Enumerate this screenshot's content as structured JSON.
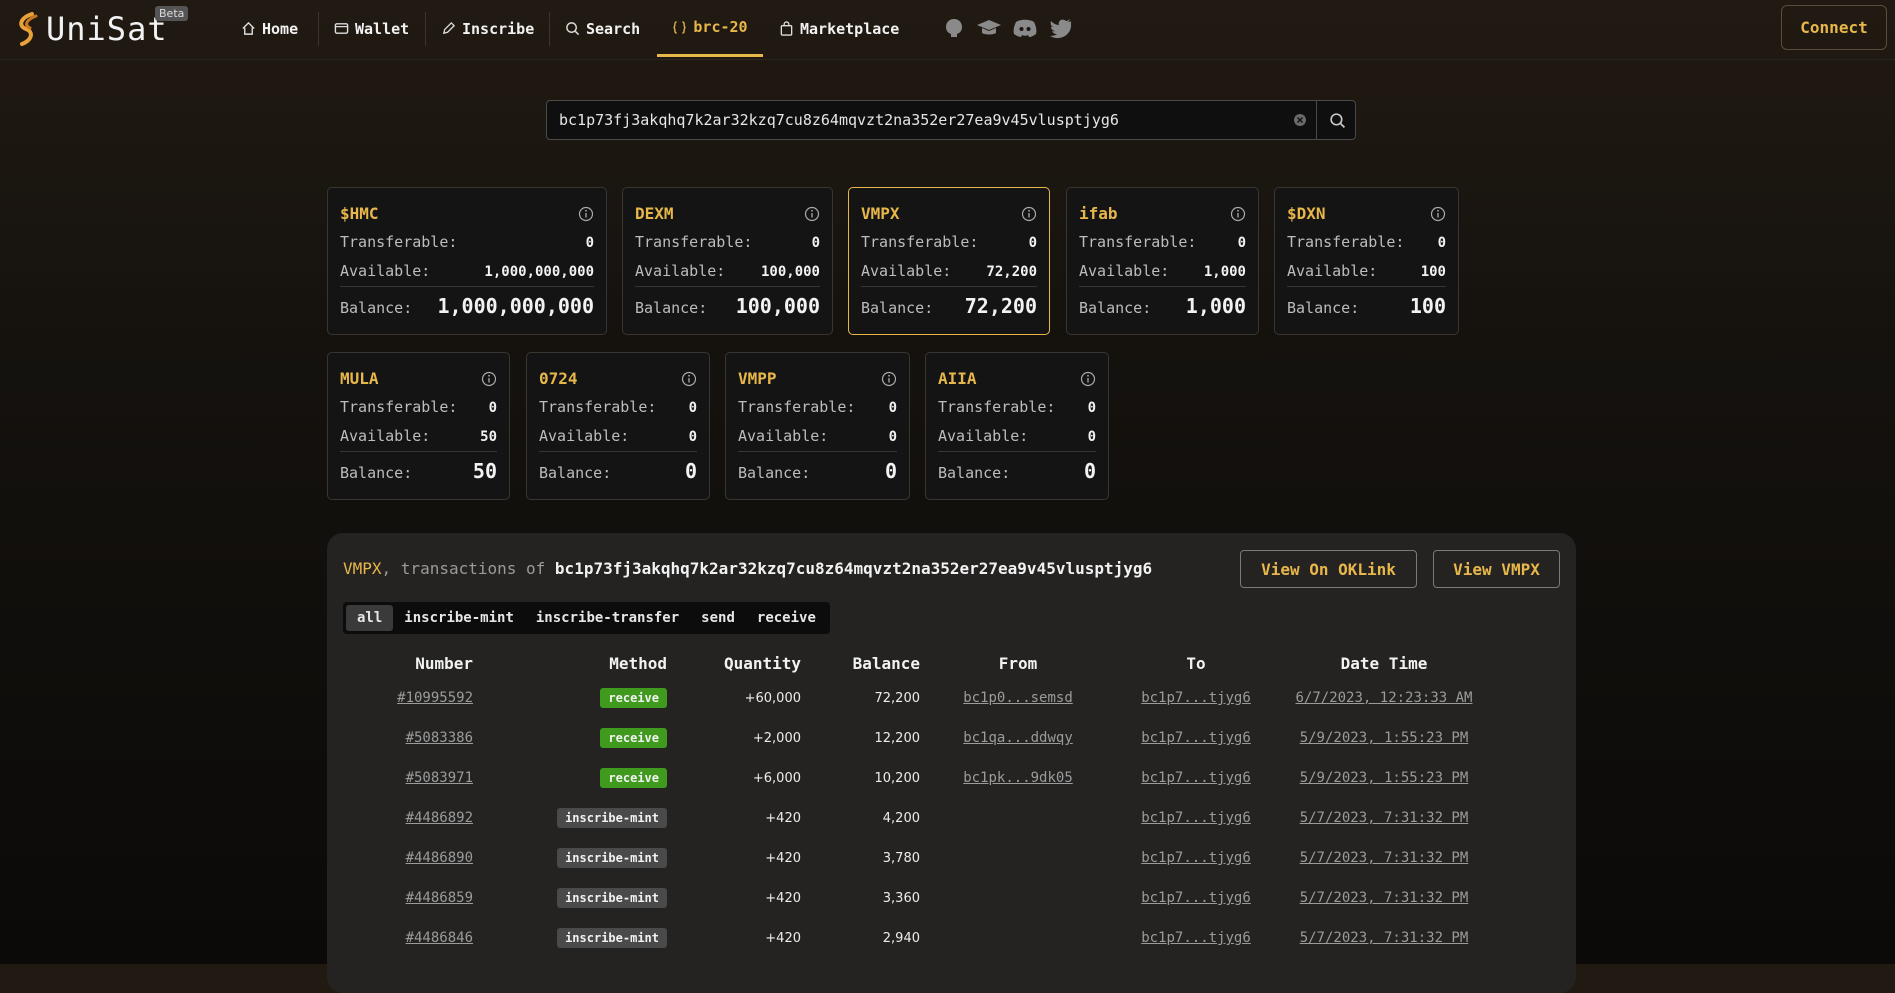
{
  "nav": {
    "brand": "UniSat",
    "beta": "Beta",
    "items": [
      {
        "label": "Home",
        "icon": "home-icon"
      },
      {
        "label": "Wallet",
        "icon": "wallet-icon"
      },
      {
        "label": "Inscribe",
        "icon": "pencil-icon"
      },
      {
        "label": "Search",
        "icon": "search-icon"
      },
      {
        "label": "brc-20",
        "icon": "braces-icon",
        "active": true
      },
      {
        "label": "Marketplace",
        "icon": "bag-icon"
      }
    ],
    "socials": [
      "github-icon",
      "academy-icon",
      "discord-icon",
      "twitter-icon"
    ],
    "connect": "Connect"
  },
  "search": {
    "value": "bc1p73fj3akqhq7k2ar32kzq7cu8z64mqvzt2na352er27ea9v45vlusptjyg6"
  },
  "tokens": [
    {
      "name": "$HMC",
      "transferable": "0",
      "available": "1,000,000,000",
      "balance": "1,000,000,000"
    },
    {
      "name": "DEXM",
      "transferable": "0",
      "available": "100,000",
      "balance": "100,000"
    },
    {
      "name": "VMPX",
      "transferable": "0",
      "available": "72,200",
      "balance": "72,200",
      "selected": true
    },
    {
      "name": "ifab",
      "transferable": "0",
      "available": "1,000",
      "balance": "1,000"
    },
    {
      "name": "$DXN",
      "transferable": "0",
      "available": "100",
      "balance": "100"
    },
    {
      "name": "MULA",
      "transferable": "0",
      "available": "50",
      "balance": "50"
    },
    {
      "name": "0724",
      "transferable": "0",
      "available": "0",
      "balance": "0"
    },
    {
      "name": "VMPP",
      "transferable": "0",
      "available": "0",
      "balance": "0"
    },
    {
      "name": "AIIA",
      "transferable": "0",
      "available": "0",
      "balance": "0"
    }
  ],
  "labels": {
    "transferable": "Transferable:",
    "available": "Available:",
    "balance": "Balance:"
  },
  "tx": {
    "ticker": "VMPX",
    "mid": ", transactions of ",
    "address": "bc1p73fj3akqhq7k2ar32kzq7cu8z64mqvzt2na352er27ea9v45vlusptjyg6",
    "btn_oklink": "View On OKLink",
    "btn_token": "View VMPX",
    "filters": [
      "all",
      "inscribe-mint",
      "inscribe-transfer",
      "send",
      "receive"
    ],
    "columns": [
      "Number",
      "Method",
      "Quantity",
      "Balance",
      "From",
      "To",
      "Date Time"
    ],
    "rows": [
      {
        "number": "#10995592",
        "method": "receive",
        "quantity": "+60,000",
        "balance": "72,200",
        "from": "bc1p0...semsd",
        "to": "bc1p7...tjyg6",
        "date": "6/7/2023, 12:23:33 AM"
      },
      {
        "number": "#5083386",
        "method": "receive",
        "quantity": "+2,000",
        "balance": "12,200",
        "from": "bc1qa...ddwqy",
        "to": "bc1p7...tjyg6",
        "date": "5/9/2023, 1:55:23 PM"
      },
      {
        "number": "#5083971",
        "method": "receive",
        "quantity": "+6,000",
        "balance": "10,200",
        "from": "bc1pk...9dk05",
        "to": "bc1p7...tjyg6",
        "date": "5/9/2023, 1:55:23 PM"
      },
      {
        "number": "#4486892",
        "method": "inscribe-mint",
        "quantity": "+420",
        "balance": "4,200",
        "from": "",
        "to": "bc1p7...tjyg6",
        "date": "5/7/2023, 7:31:32 PM"
      },
      {
        "number": "#4486890",
        "method": "inscribe-mint",
        "quantity": "+420",
        "balance": "3,780",
        "from": "",
        "to": "bc1p7...tjyg6",
        "date": "5/7/2023, 7:31:32 PM"
      },
      {
        "number": "#4486859",
        "method": "inscribe-mint",
        "quantity": "+420",
        "balance": "3,360",
        "from": "",
        "to": "bc1p7...tjyg6",
        "date": "5/7/2023, 7:31:32 PM"
      },
      {
        "number": "#4486846",
        "method": "inscribe-mint",
        "quantity": "+420",
        "balance": "2,940",
        "from": "",
        "to": "bc1p7...tjyg6",
        "date": "5/7/2023, 7:31:32 PM"
      }
    ]
  },
  "colors": {
    "accent": "#e8b74a",
    "receive": "#3f9a1e",
    "mint": "#4a4a4a"
  }
}
